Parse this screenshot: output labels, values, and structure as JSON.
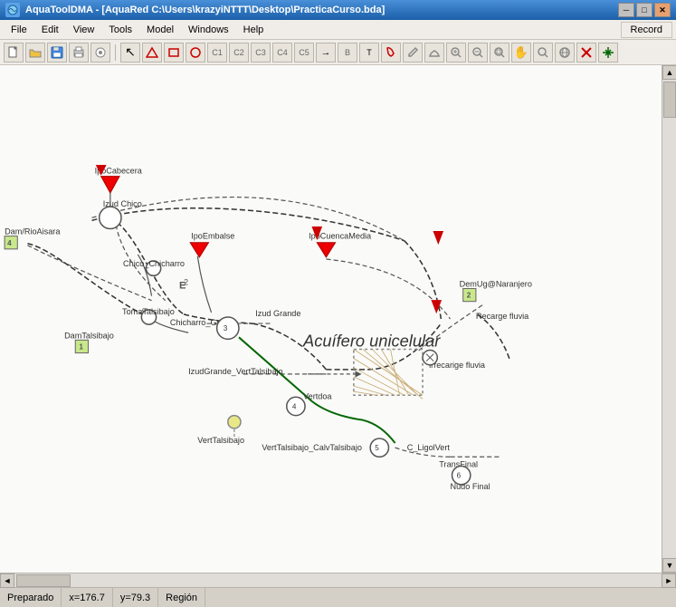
{
  "titlebar": {
    "title": "AquaToolDMA - [AquaRed C:\\Users\\krazyiNTTT\\Desktop\\PracticaCurso.bda]",
    "app_icon": "A",
    "min_btn": "─",
    "max_btn": "□",
    "close_btn": "✕"
  },
  "menu": {
    "items": [
      "File",
      "Edit",
      "View",
      "Tools",
      "Model",
      "Windows",
      "Help"
    ]
  },
  "toolbar": {
    "record_label": "Record"
  },
  "statusbar": {
    "status": "Preparado",
    "x_coord": "x=176.7",
    "y_coord": "y=79.3",
    "region": "Región"
  },
  "diagram": {
    "title": "Acuífero unicelular",
    "nodes": [
      {
        "id": "IpoCabecera",
        "label": "IpoCabecera"
      },
      {
        "id": "IzudChico",
        "label": "Izud Chico"
      },
      {
        "id": "DamRioAisara",
        "label": "Dam/RioAisara"
      },
      {
        "id": "ChicoChicharro",
        "label": "Chico_Chicharro"
      },
      {
        "id": "IpoEmbalse",
        "label": "IpoEmbalse"
      },
      {
        "id": "IpoCuencaMedia",
        "label": "IpoCuencaMedia"
      },
      {
        "id": "TomaTalsibajo",
        "label": "TomaTalsibajo"
      },
      {
        "id": "ChicharroGrande",
        "label": "Chicharro_Grande"
      },
      {
        "id": "IzudGrande",
        "label": "Izud Grande"
      },
      {
        "id": "DamTalsibajo",
        "label": "DamTalsibajo"
      },
      {
        "id": "IzudGrandeVertTalsibajo",
        "label": "IzudGrande_VertTalsibajo"
      },
      {
        "id": "Vertdoa",
        "label": "Vertdoa"
      },
      {
        "id": "VertTalsibajo",
        "label": "VertTalsibajo"
      },
      {
        "id": "VertTalsibajoCalvTalsibajo",
        "label": "VertTalsibajo_CalvTalsibajo"
      },
      {
        "id": "DemUgOranjero",
        "label": "DemUg@Naranjero"
      },
      {
        "id": "RecargeFluvia",
        "label": "Recarge fluvia"
      },
      {
        "id": "IrrecargeFluvia",
        "label": "irrecarige fluvia"
      },
      {
        "id": "CLigolVert",
        "label": "C_LigolVert"
      },
      {
        "id": "TransFinal",
        "label": "TransFinal"
      },
      {
        "id": "NudoFinal",
        "label": "Nudo Final"
      }
    ]
  }
}
